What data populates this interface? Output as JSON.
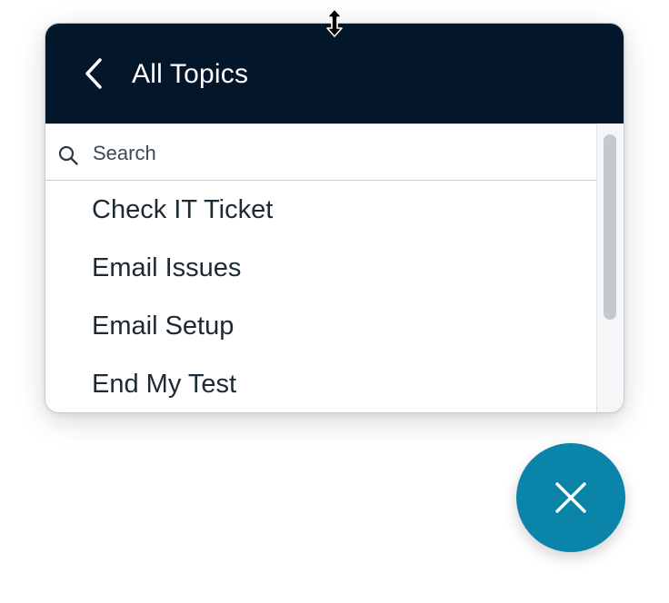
{
  "header": {
    "title": "All Topics",
    "back_icon": "chevron-left-icon"
  },
  "search": {
    "placeholder": "Search",
    "value": "",
    "icon": "search-icon"
  },
  "topics": [
    {
      "label": "Check IT Ticket"
    },
    {
      "label": "Email Issues"
    },
    {
      "label": "Email Setup"
    },
    {
      "label": "End My Test"
    }
  ],
  "fab": {
    "icon": "close-icon",
    "color": "#0a84a8"
  },
  "colors": {
    "header_bg": "#03162a",
    "accent": "#0a84a8"
  }
}
